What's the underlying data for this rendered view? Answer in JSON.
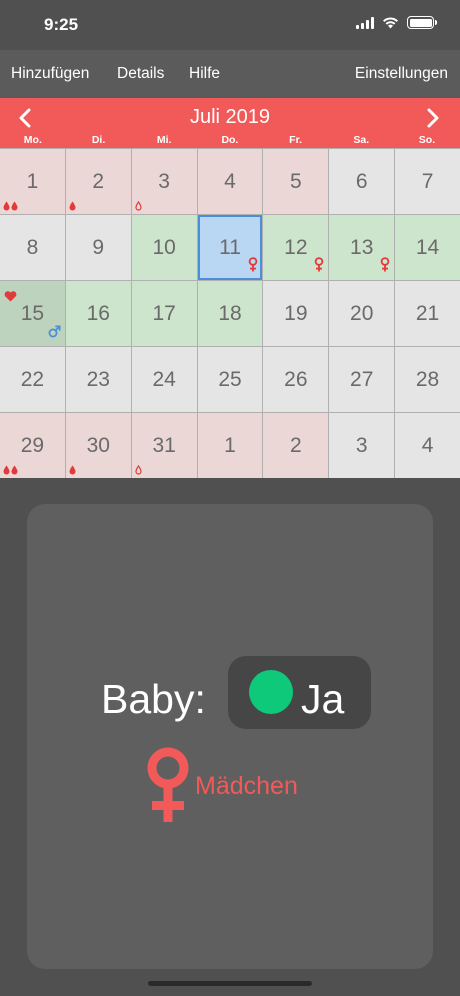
{
  "status_bar": {
    "time": "9:25"
  },
  "toolbar": {
    "add_label": "Hinzufügen",
    "details_label": "Details",
    "help_label": "Hilfe",
    "settings_label": "Einstellungen"
  },
  "calendar": {
    "month_title": "Juli 2019",
    "weekdays": [
      "Mo.",
      "Di.",
      "Mi.",
      "Do.",
      "Fr.",
      "Sa.",
      "So."
    ],
    "days": [
      {
        "d": "1",
        "type": "period",
        "icons": [
          "drop",
          "drop"
        ]
      },
      {
        "d": "2",
        "type": "period",
        "icons": [
          "drop"
        ]
      },
      {
        "d": "3",
        "type": "period",
        "icons": [
          "drop-outline"
        ]
      },
      {
        "d": "4",
        "type": "period"
      },
      {
        "d": "5",
        "type": "period"
      },
      {
        "d": "6",
        "type": "normal"
      },
      {
        "d": "7",
        "type": "normal"
      },
      {
        "d": "8",
        "type": "normal"
      },
      {
        "d": "9",
        "type": "normal"
      },
      {
        "d": "10",
        "type": "fertile"
      },
      {
        "d": "11",
        "type": "selected",
        "br": "female"
      },
      {
        "d": "12",
        "type": "fertile",
        "br": "female"
      },
      {
        "d": "13",
        "type": "fertile",
        "br": "female"
      },
      {
        "d": "14",
        "type": "fertile"
      },
      {
        "d": "15",
        "type": "ovulation",
        "br": "male",
        "tl": "heart"
      },
      {
        "d": "16",
        "type": "fertile"
      },
      {
        "d": "17",
        "type": "fertile"
      },
      {
        "d": "18",
        "type": "fertile"
      },
      {
        "d": "19",
        "type": "normal"
      },
      {
        "d": "20",
        "type": "normal"
      },
      {
        "d": "21",
        "type": "normal"
      },
      {
        "d": "22",
        "type": "normal"
      },
      {
        "d": "23",
        "type": "normal"
      },
      {
        "d": "24",
        "type": "normal"
      },
      {
        "d": "25",
        "type": "normal"
      },
      {
        "d": "26",
        "type": "normal"
      },
      {
        "d": "27",
        "type": "normal"
      },
      {
        "d": "28",
        "type": "normal"
      },
      {
        "d": "29",
        "type": "period",
        "icons": [
          "drop",
          "drop"
        ]
      },
      {
        "d": "30",
        "type": "period",
        "icons": [
          "drop"
        ]
      },
      {
        "d": "31",
        "type": "period",
        "icons": [
          "drop-outline"
        ]
      },
      {
        "d": "1",
        "type": "period"
      },
      {
        "d": "2",
        "type": "period"
      },
      {
        "d": "3",
        "type": "normal"
      },
      {
        "d": "4",
        "type": "normal"
      }
    ]
  },
  "panel": {
    "baby_label": "Baby:",
    "toggle_text": "Ja",
    "gender_text": "Mädchen"
  },
  "colors": {
    "accent_red": "#f25a5a",
    "toggle_green": "#0ec97a",
    "male_blue": "#4a90d9"
  }
}
